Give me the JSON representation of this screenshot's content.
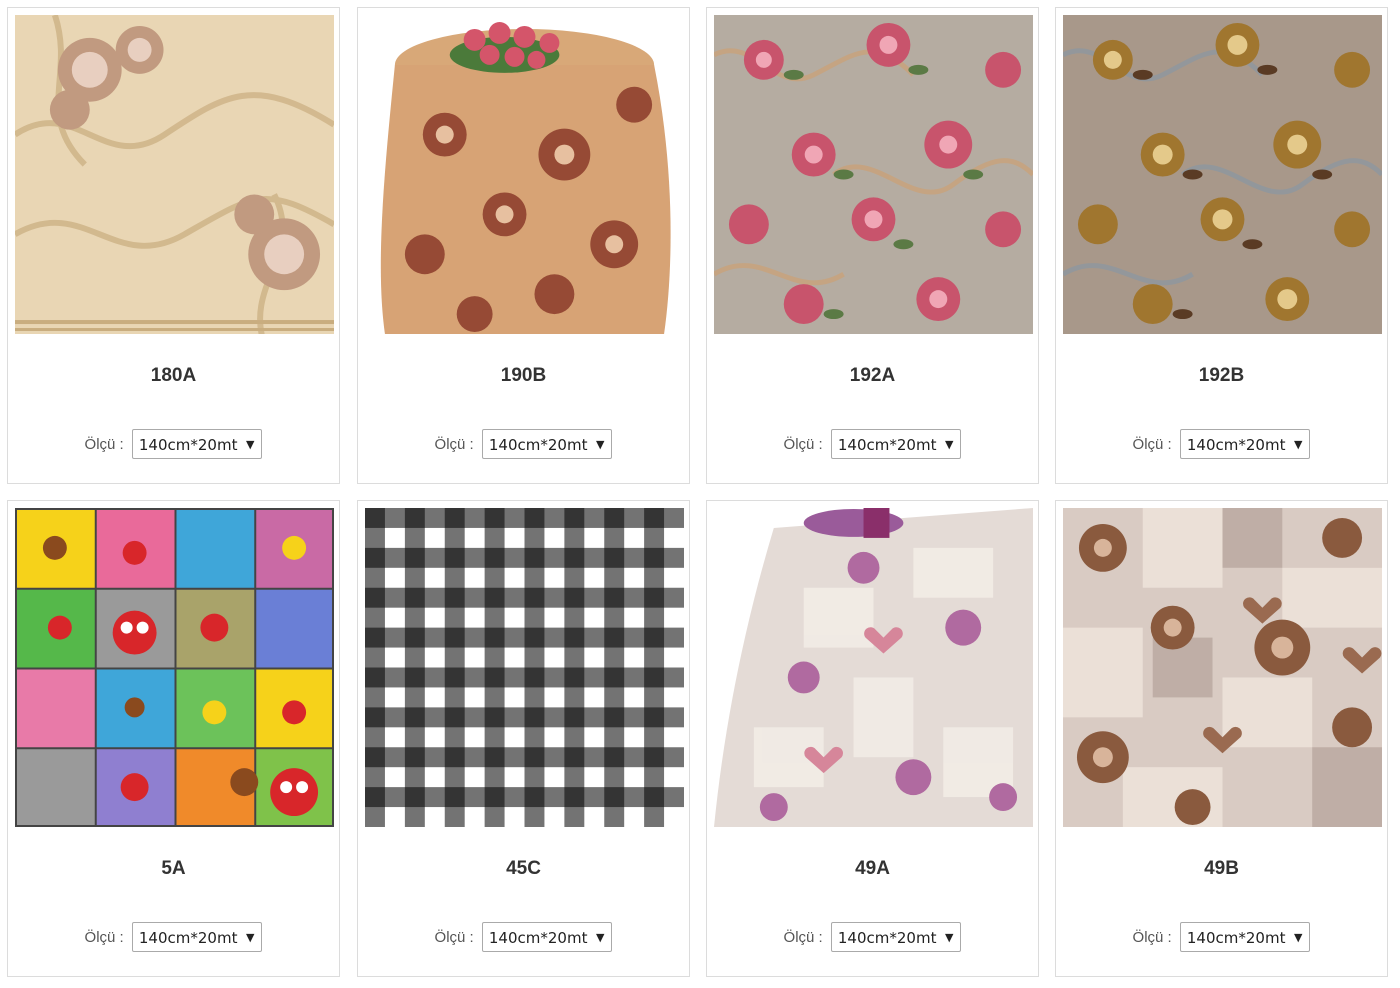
{
  "products": [
    {
      "code": "180A",
      "size_label": "Ölçü :",
      "size_value": "140cm*20mt",
      "pattern": "cream-floral-swirl"
    },
    {
      "code": "190B",
      "size_label": "Ölçü :",
      "size_value": "140cm*20mt",
      "pattern": "tan-rose-tablecloth"
    },
    {
      "code": "192A",
      "size_label": "Ölçü :",
      "size_value": "140cm*20mt",
      "pattern": "grey-pink-rose"
    },
    {
      "code": "192B",
      "size_label": "Ölçü :",
      "size_value": "140cm*20mt",
      "pattern": "brown-gold-rose"
    },
    {
      "code": "5A",
      "size_label": "Ölçü :",
      "size_value": "140cm*20mt",
      "pattern": "kids-patchwork"
    },
    {
      "code": "45C",
      "size_label": "Ölçü :",
      "size_value": "140cm*20mt",
      "pattern": "black-white-gingham"
    },
    {
      "code": "49A",
      "size_label": "Ölçü :",
      "size_value": "140cm*20mt",
      "pattern": "lilac-rose-tablecloth"
    },
    {
      "code": "49B",
      "size_label": "Ölçü :",
      "size_value": "140cm*20mt",
      "pattern": "beige-rose-heart-patchwork"
    }
  ],
  "colors": {
    "border": "#dcdcdc",
    "title": "#333333",
    "label": "#555555"
  }
}
